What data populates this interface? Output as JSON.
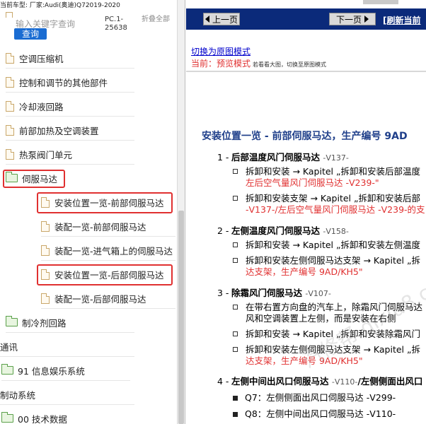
{
  "left_panel": {
    "top_info": "当前车型:   厂家:Audi(奥迪)Q72019-2020",
    "search": {
      "placeholder": "输入关键字查询",
      "button": "查询"
    },
    "pc_code": "PC.1-25638",
    "collapse_all": "折叠全部",
    "tree": [
      {
        "label": "空调压缩机",
        "icon": "doc-icon"
      },
      {
        "label": "控制和调节的其他部件",
        "icon": "doc-icon"
      },
      {
        "label": "冷却液回路",
        "icon": "doc-icon"
      },
      {
        "label": "前部加热及空调装置",
        "icon": "doc-icon"
      },
      {
        "label": "热泵阀门单元",
        "icon": "doc-icon"
      },
      {
        "label": "伺服马达",
        "icon": "folder-open-icon"
      },
      {
        "label": "安装位置一览-前部伺服马达",
        "icon": "doc-icon",
        "highlighted": true
      },
      {
        "label": "装配一览-前部伺服马达",
        "icon": "doc-icon"
      },
      {
        "label": "装配一览-进气箱上的伺服马达",
        "icon": "doc-icon"
      },
      {
        "label": "安装位置一览-后部伺服马达",
        "icon": "doc-icon",
        "highlighted": true
      },
      {
        "label": "装配一览-后部伺服马达",
        "icon": "doc-icon"
      },
      {
        "label": "制冷剂回路",
        "icon": "folder-icon"
      },
      {
        "label": "通讯",
        "icon": ""
      },
      {
        "label": "91 信息娱乐系统",
        "icon": "folder-icon"
      },
      {
        "label": "制动系统",
        "icon": ""
      },
      {
        "label": "00 技术数据",
        "icon": "folder-icon"
      }
    ]
  },
  "right_panel": {
    "nav": {
      "prev": "上一页",
      "next": "下一页",
      "refresh": "[刷新当前"
    },
    "switch_link": "切换为原图模式",
    "current_prefix": "当前：",
    "current_mode": "预览模式",
    "current_hint": "若看看大图，切换至原图模式",
    "doc_title": "安装位置一览 - 前部伺服马达，生产编号 9AD",
    "sections": [
      {
        "num": "1 -",
        "title": "后部温度风门伺服马达",
        "code": "-V137-",
        "bullets": [
          {
            "lines": [
              "拆卸和安装 → Kapitel „拆卸和安装后部温度",
              "左后空气量风门伺服马达 -V239-\""
            ]
          },
          {
            "lines": [
              "拆卸和安装支架 → Kapitel „拆卸和安装后部",
              "-V137-/左后空气量风门伺服马达 -V239-的支"
            ]
          }
        ]
      },
      {
        "num": "2 -",
        "title": "左侧温度风门伺服马达",
        "code": "-V158-",
        "bullets": [
          {
            "lines": [
              "拆卸和安装 → Kapitel „拆卸和安装左侧温度"
            ]
          },
          {
            "lines": [
              "拆卸和安装左侧伺服马达支架 → Kapitel „拆",
              "达支架，生产编号 9AD/KH5\""
            ]
          }
        ]
      },
      {
        "num": "3 -",
        "title": "除霜风门伺服马达",
        "code": "-V107-",
        "bullets": [
          {
            "lines": [
              "在带右置方向盘的汽车上，除霜风门伺服马达",
              "风和空调装置上左侧，而是安装在右侧"
            ]
          },
          {
            "lines": [
              "拆卸和安装 → Kapitel „拆卸和安装除霜风门"
            ]
          },
          {
            "lines": [
              "拆卸和安装左侧伺服马达支架 → Kapitel „拆",
              "达支架，生产编号 9AD/KH5\""
            ]
          }
        ]
      },
      {
        "num": "4 -",
        "title": "左侧中间出风口伺服马达",
        "code": "-V110-",
        "title2": "/左侧侧面出风口",
        "subs": [
          "Q7：左侧侧面出风口伺服马达 -V299-",
          "Q8：左侧中间出风口伺服马达 -V110-"
        ]
      }
    ],
    "watermark": "汽修帮 qixiu8.com"
  },
  "colors": {
    "nav_bg": "#0b2a7a",
    "link": "#0000cc",
    "red": "#e03030",
    "title": "#1f3f8a",
    "accent": "#1a6cd2"
  }
}
